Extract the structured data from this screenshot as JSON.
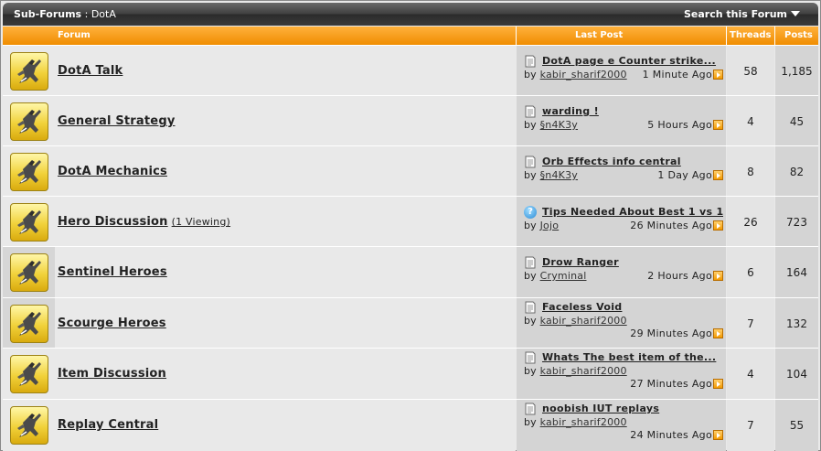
{
  "header": {
    "section": "Sub-Forums",
    "separator": ":",
    "current": "DotA",
    "search_label": "Search this Forum"
  },
  "columns": {
    "forum": "Forum",
    "last_post": "Last Post",
    "threads": "Threads",
    "posts": "Posts"
  },
  "colors": {
    "header_bg": "#3a3a3a",
    "column_header_bg": "#f39a10",
    "row_bg": "#e9e9e9",
    "last_post_bg": "#d4d4d4"
  },
  "forums": [
    {
      "title": "DotA Talk",
      "viewing": "",
      "last_post": {
        "icon": "document-icon",
        "title": "DotA page e Counter strike...",
        "by": "by",
        "user": "kabir_sharif2000",
        "time": "1 Minute Ago"
      },
      "threads": "58",
      "posts": "1,185"
    },
    {
      "title": "General Strategy",
      "viewing": "",
      "last_post": {
        "icon": "document-icon",
        "title": "warding !",
        "by": "by",
        "user": "§n4K3y",
        "time": "5 Hours Ago"
      },
      "threads": "4",
      "posts": "45"
    },
    {
      "title": "DotA Mechanics",
      "viewing": "",
      "last_post": {
        "icon": "document-icon",
        "title": "Orb Effects info central",
        "by": "by",
        "user": "§n4K3y",
        "time": "1 Day Ago"
      },
      "threads": "8",
      "posts": "82"
    },
    {
      "title": "Hero Discussion",
      "viewing": "(1 Viewing)",
      "last_post": {
        "icon": "question-icon",
        "title": "Tips Needed About Best 1 vs 1",
        "by": "by",
        "user": "Jojo",
        "time": "26 Minutes Ago"
      },
      "threads": "26",
      "posts": "723"
    },
    {
      "title": "Sentinel Heroes",
      "viewing": "",
      "last_post": {
        "icon": "document-icon",
        "title": "Drow Ranger",
        "by": "by",
        "user": "Cryminal",
        "time": "2 Hours Ago"
      },
      "threads": "6",
      "posts": "164"
    },
    {
      "title": "Scourge Heroes",
      "viewing": "",
      "last_post": {
        "icon": "document-icon",
        "title": "Faceless Void",
        "by": "by",
        "user": "kabir_sharif2000",
        "time": "29 Minutes Ago"
      },
      "threads": "7",
      "posts": "132"
    },
    {
      "title": "Item Discussion",
      "viewing": "",
      "last_post": {
        "icon": "document-icon",
        "title": "Whats The best item of the...",
        "by": "by",
        "user": "kabir_sharif2000",
        "time": "27 Minutes Ago"
      },
      "threads": "4",
      "posts": "104"
    },
    {
      "title": "Replay Central",
      "viewing": "",
      "last_post": {
        "icon": "document-icon",
        "title": "noobish IUT replays",
        "by": "by",
        "user": "kabir_sharif2000",
        "time": "24 Minutes Ago"
      },
      "threads": "7",
      "posts": "55"
    }
  ]
}
